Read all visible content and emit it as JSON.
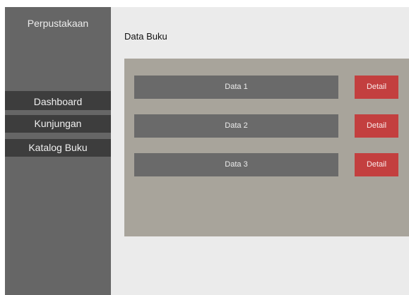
{
  "sidebar": {
    "title": "Perpustakaan",
    "items": [
      {
        "label": "Dashboard"
      },
      {
        "label": "Kunjungan"
      },
      {
        "label": "Katalog Buku"
      }
    ]
  },
  "main": {
    "title": "Data Buku",
    "rows": [
      {
        "label": "Data 1",
        "button": "Detail"
      },
      {
        "label": "Data 2",
        "button": "Detail"
      },
      {
        "label": "Data 3",
        "button": "Detail"
      }
    ]
  },
  "colors": {
    "sidebar": "#666666",
    "nav_item": "#3d3d3d",
    "content_bg": "#ebebeb",
    "panel": "#a8a49b",
    "row_bar": "#6a6a6a",
    "detail_button": "#c33f3f"
  }
}
